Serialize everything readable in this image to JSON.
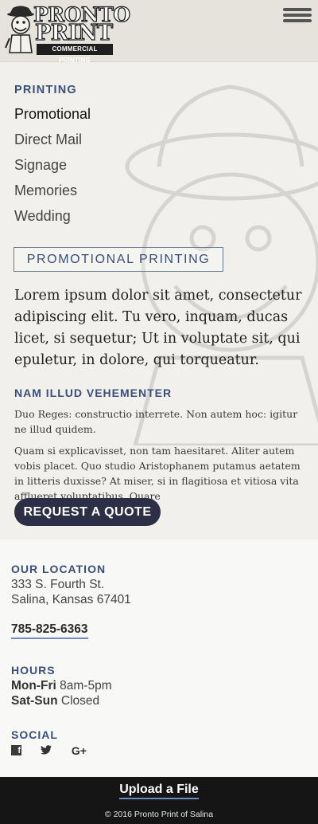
{
  "header": {
    "logo_line1": "PRONTO",
    "logo_line2": "PRINT",
    "logo_tagline": "COMMERCIAL PRINTING",
    "menu_icon": "hamburger-icon"
  },
  "sidebar": {
    "section_label": "PRINTING",
    "items": [
      {
        "label": "Promotional",
        "active": true
      },
      {
        "label": "Direct Mail",
        "active": false
      },
      {
        "label": "Signage",
        "active": false
      },
      {
        "label": "Memories",
        "active": false
      },
      {
        "label": "Wedding",
        "active": false
      }
    ]
  },
  "main": {
    "page_title": "PROMOTIONAL PRINTING",
    "lead": "Lorem ipsum dolor sit amet, consectetur adipiscing elit. Tu vero, inquam, ducas licet, si sequetur; Ut in voluptate sit, qui epuletur, in dolore, qui torqueatur.",
    "subheading": "NAM ILLUD VEHEMENTER",
    "paragraph1": "Duo Reges: constructio interrete. Non autem hoc: igitur ne illud quidem.",
    "paragraph2": "Quam si explicavisset, non tam haesitaret. Aliter autem vobis placet. Quo studio Aristophanem putamus aetatem in litteris duxisse? At miser, si in flagitiosa et vitiosa vita afflueret voluptatibus. Quare",
    "quote_button": "REQUEST A QUOTE"
  },
  "footer": {
    "location_label": "OUR LOCATION",
    "address_line1": "333 S. Fourth St.",
    "address_line2": "Salina, Kansas 67401",
    "phone": "785-825-6363",
    "hours_label": "HOURS",
    "hours": [
      {
        "days": "Mon-Fri",
        "time": "8am-5pm"
      },
      {
        "days": "Sat-Sun",
        "time": "Closed"
      }
    ],
    "social_label": "SOCIAL",
    "social_icons": [
      "facebook-icon",
      "twitter-icon",
      "google-plus-icon"
    ],
    "upload_link": "Upload a File",
    "copyright": "© 2016 Pronto Print of Salina"
  },
  "colors": {
    "accent": "#3a4f77",
    "button": "#2d2f47",
    "link_underline": "#6f88c6",
    "footer_bar": "#151515"
  }
}
